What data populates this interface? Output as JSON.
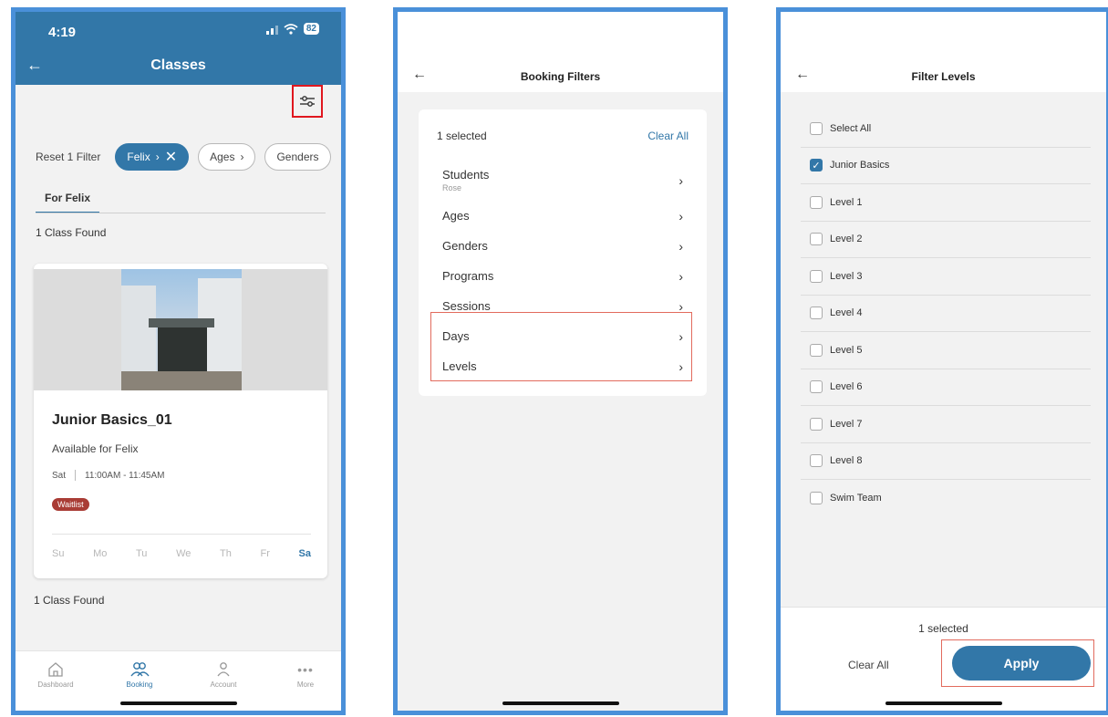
{
  "screen1": {
    "status": {
      "time": "4:19",
      "battery": "82"
    },
    "header": {
      "title": "Classes"
    },
    "filters": {
      "reset_label": "Reset 1 Filter",
      "chips": [
        {
          "label": "Felix",
          "active": true
        },
        {
          "label": "Ages",
          "active": false
        },
        {
          "label": "Genders",
          "active": false
        }
      ]
    },
    "tab": {
      "label": "For Felix"
    },
    "results_count": "1 Class Found",
    "class_card": {
      "title": "Junior Basics_01",
      "availability": "Available for Felix",
      "day": "Sat",
      "time": "11:00AM - 11:45AM",
      "badge": "Waitlist",
      "weekdays": [
        "Su",
        "Mo",
        "Tu",
        "We",
        "Th",
        "Fr",
        "Sa"
      ],
      "selected_day": "Sa"
    },
    "results_count_bottom": "1 Class Found",
    "tabbar": [
      {
        "label": "Dashboard",
        "icon": "home-icon"
      },
      {
        "label": "Booking",
        "icon": "people-icon",
        "active": true
      },
      {
        "label": "Account",
        "icon": "person-icon"
      },
      {
        "label": "More",
        "icon": "more-icon"
      }
    ]
  },
  "screen2": {
    "header": {
      "title": "Booking Filters"
    },
    "selected_text": "1 selected",
    "clear_all": "Clear All",
    "items": [
      {
        "label": "Students",
        "sub": "Rose"
      },
      {
        "label": "Ages"
      },
      {
        "label": "Genders"
      },
      {
        "label": "Programs"
      },
      {
        "label": "Sessions"
      },
      {
        "label": "Days"
      },
      {
        "label": "Levels"
      }
    ]
  },
  "screen3": {
    "header": {
      "title": "Filter Levels"
    },
    "levels": [
      {
        "label": "Select All",
        "checked": false
      },
      {
        "label": "Junior Basics",
        "checked": true
      },
      {
        "label": "Level 1",
        "checked": false
      },
      {
        "label": "Level 2",
        "checked": false
      },
      {
        "label": "Level 3",
        "checked": false
      },
      {
        "label": "Level 4",
        "checked": false
      },
      {
        "label": "Level 5",
        "checked": false
      },
      {
        "label": "Level 6",
        "checked": false
      },
      {
        "label": "Level 7",
        "checked": false
      },
      {
        "label": "Level 8",
        "checked": false
      },
      {
        "label": "Swim Team",
        "checked": false
      }
    ],
    "footer": {
      "selected_text": "1 selected",
      "clear_all": "Clear All",
      "apply": "Apply"
    }
  },
  "colors": {
    "primary": "#3277a8",
    "frame": "#4a90d9",
    "highlight": "#e0171f",
    "waitlist": "#a93c35"
  }
}
